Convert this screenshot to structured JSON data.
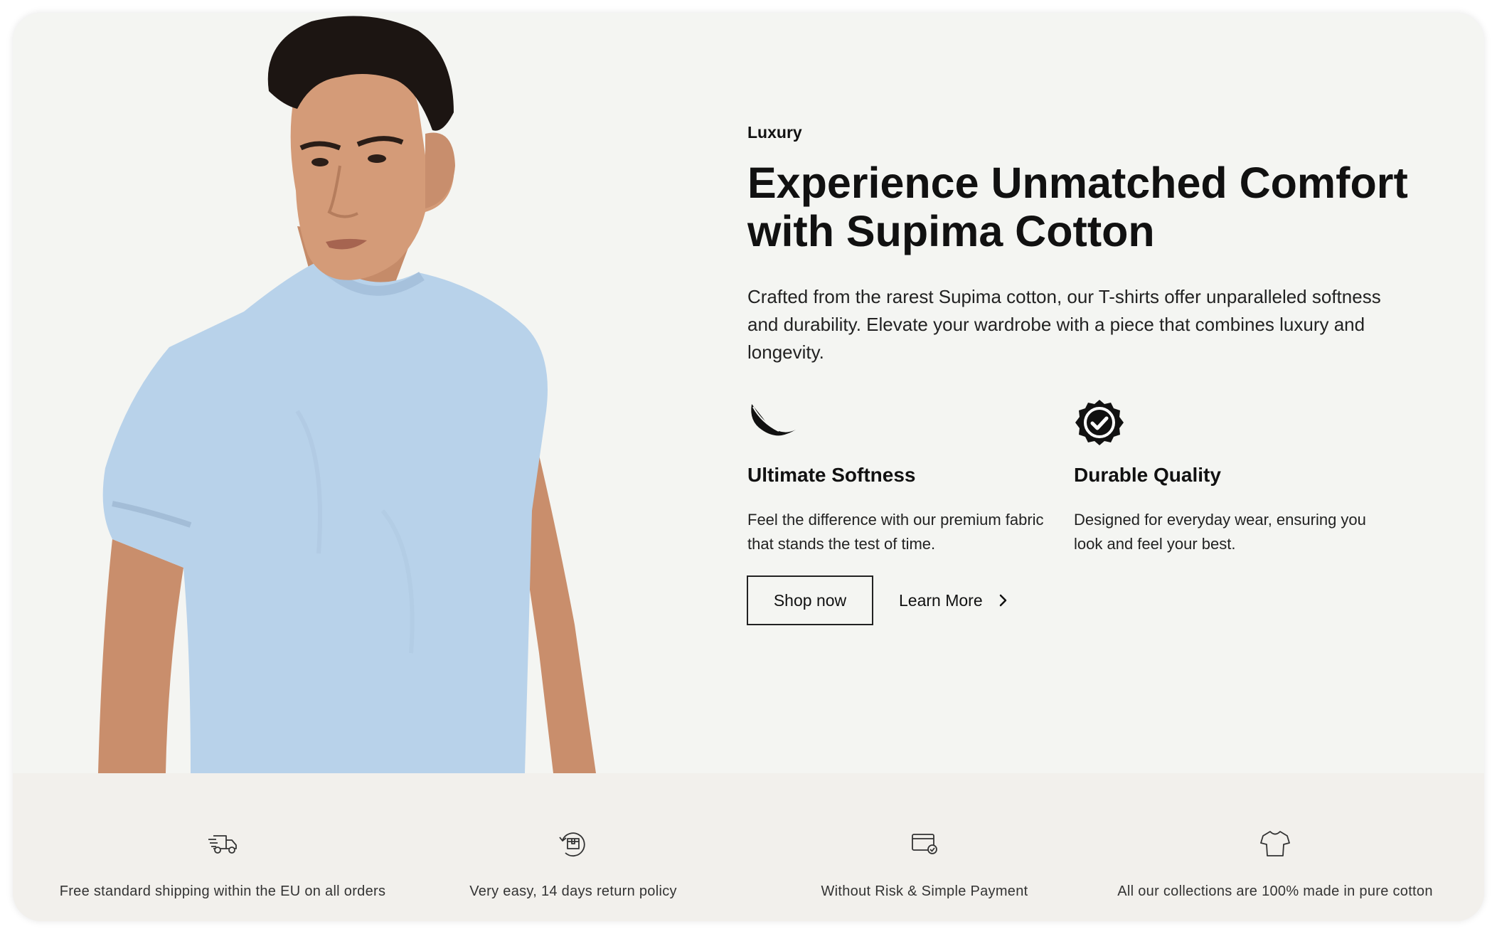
{
  "hero": {
    "eyebrow": "Luxury",
    "headline": "Experience Unmatched Comfort with Supima Cotton",
    "lede": "Crafted from the rarest Supima cotton, our T-shirts offer unparalleled softness and durability. Elevate your wardrobe with a piece that combines luxury and longevity.",
    "features": [
      {
        "icon": "feather-icon",
        "title": "Ultimate Softness",
        "description": "Feel the difference with our premium fabric that stands the test of time."
      },
      {
        "icon": "badge-check-icon",
        "title": "Durable Quality",
        "description": "Designed for everyday wear, ensuring you look and feel your best."
      }
    ],
    "shop_label": "Shop now",
    "learn_label": "Learn More",
    "shirt_color": "#b8d2ea"
  },
  "benefits": [
    {
      "icon": "truck-icon",
      "text": "Free standard shipping within the EU on all orders"
    },
    {
      "icon": "return-box-icon",
      "text": "Very easy, 14 days return policy"
    },
    {
      "icon": "card-payment-icon",
      "text": "Without Risk & Simple Payment"
    },
    {
      "icon": "tshirt-icon",
      "text": "All our collections are 100% made in pure cotton"
    }
  ]
}
